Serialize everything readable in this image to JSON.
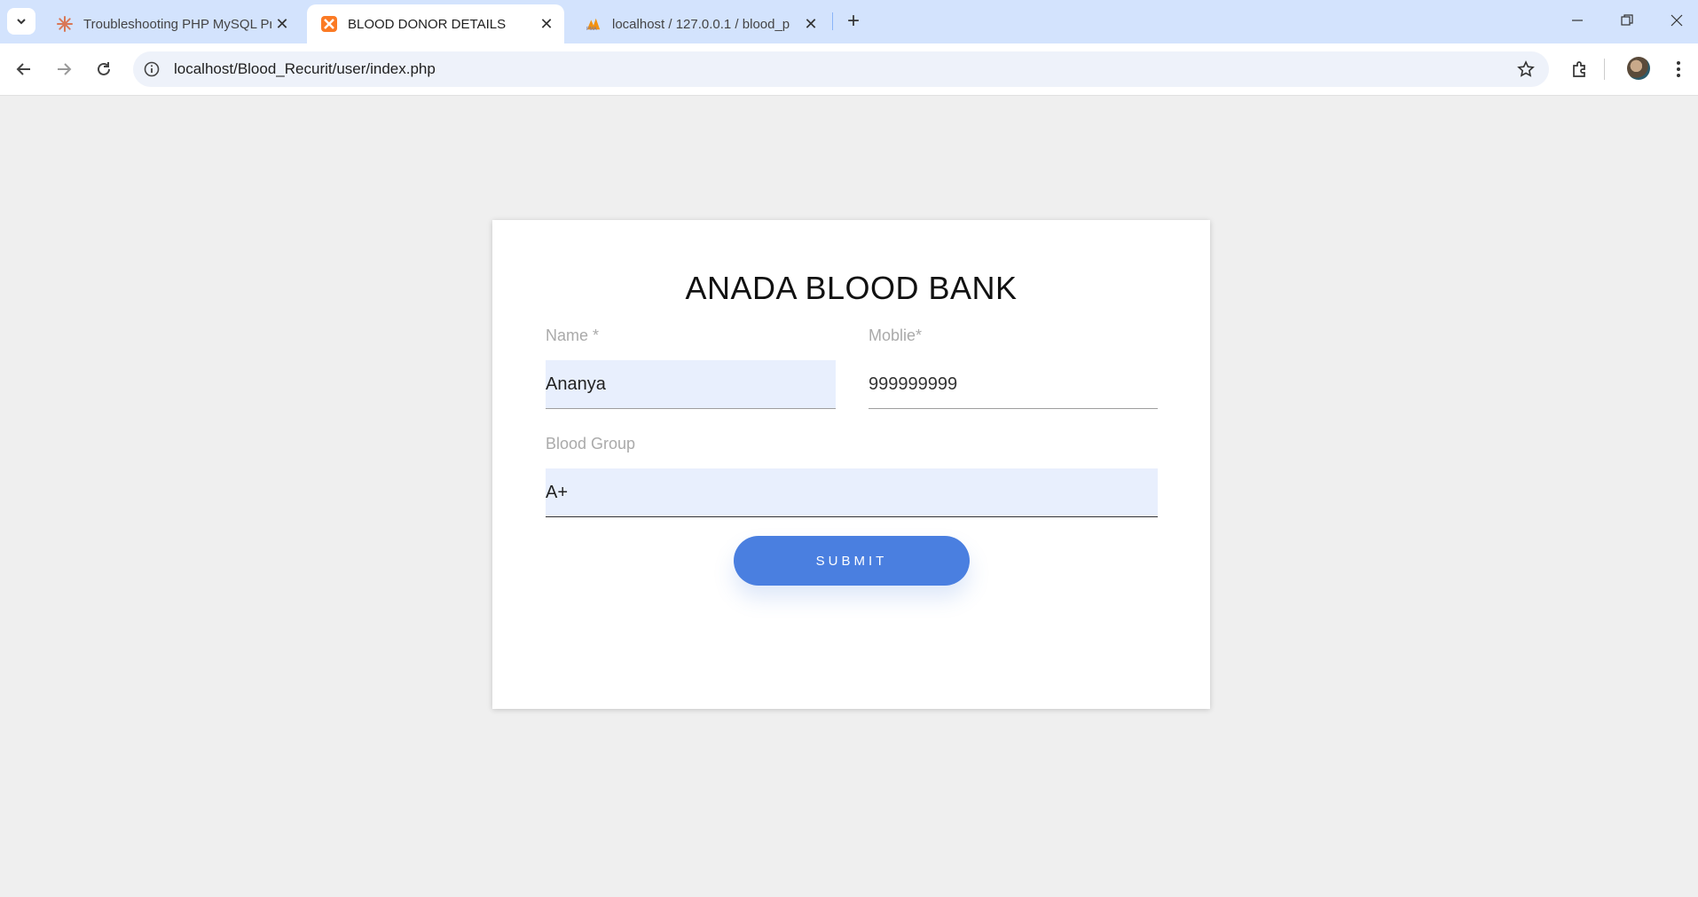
{
  "browser": {
    "tabs": [
      {
        "title": "Troubleshooting PHP MySQL Pr",
        "active": false,
        "icon": "sparkle-icon"
      },
      {
        "title": "BLOOD DONOR DETAILS",
        "active": true,
        "icon": "xampp-icon"
      },
      {
        "title": "localhost / 127.0.0.1 / blood_p",
        "active": false,
        "icon": "phpmyadmin-icon"
      }
    ],
    "url": "localhost/Blood_Recurit/user/index.php"
  },
  "page": {
    "heading": "ANADA BLOOD BANK",
    "name_label": "Name *",
    "name_value": "Ananya",
    "mobile_label": "Moblie*",
    "mobile_value": "999999999",
    "blood_group_label": "Blood Group",
    "blood_group_value": "A+",
    "submit_label": "SUBMIT"
  },
  "colors": {
    "accent": "#4a7fe0",
    "autofill": "#e8effd",
    "tabbar": "#d3e3fd"
  }
}
